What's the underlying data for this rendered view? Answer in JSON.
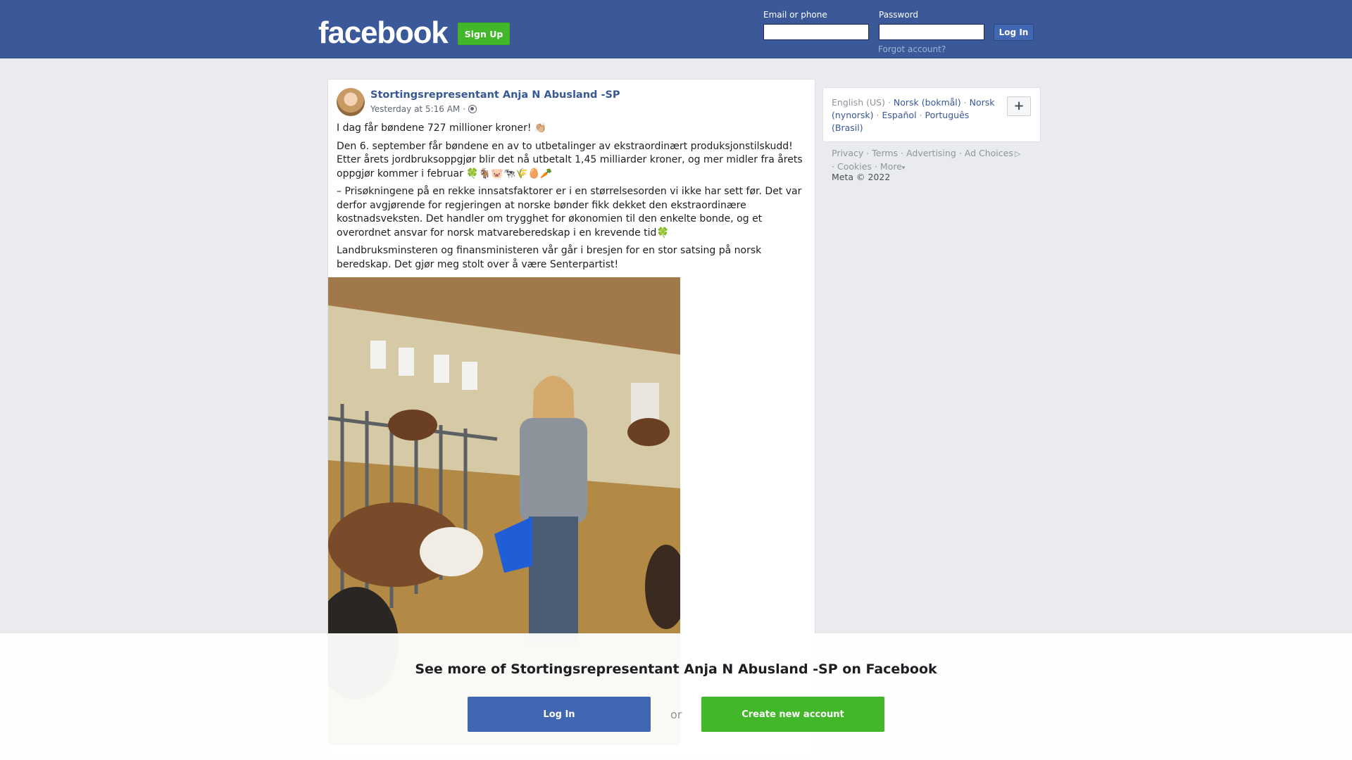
{
  "header": {
    "logo": "facebook",
    "signup_label": "Sign Up",
    "email_label": "Email or phone",
    "password_label": "Password",
    "login_label": "Log In",
    "forgot_label": "Forgot account?"
  },
  "post": {
    "author": "Stortingsrepresentant Anja N Abusland -SP",
    "timestamp": "Yesterday at 5:16 AM",
    "separator": "·",
    "paragraphs": [
      "I dag får bøndene 727 millioner kroner! 👏🏼",
      "Den 6. september får bøndene en av to utbetalinger av ekstraordinært produksjonstilskudd! Etter årets jordbruksoppgjør blir det nå utbetalt 1,45 milliarder kroner, og mer midler fra årets oppgjør kommer i februar 🍀🐐🐷🐄🌾🥚🥕",
      "– Prisøkningene på en rekke innsatsfaktorer er i en størrelsesorden vi ikke har sett før. Det var derfor avgjørende for regjeringen at norske bønder fikk dekket den ekstraordinære kostnadsveksten. Det handler om trygghet for økonomien til den enkelte bonde, og et overordnet ansvar for norsk matvareberedskap i en krevende tid🍀",
      "Landbruksminsteren og finansministeren vår går i bresjen for en stor satsing på norsk beredskap. Det gjør meg stolt over å være Senterpartist!"
    ]
  },
  "sidebar": {
    "languages": {
      "current": "English (US)",
      "options": [
        "Norsk (bokmål)",
        "Norsk (nynorsk)",
        "Español",
        "Português (Brasil)"
      ],
      "dot": "·"
    },
    "add_language": "+",
    "footer_links": [
      "Privacy",
      "Terms",
      "Advertising",
      "Ad Choices",
      "Cookies",
      "More"
    ],
    "more_caret": "▾",
    "copyright": "Meta © 2022"
  },
  "overlay": {
    "title": "See more of Stortingsrepresentant Anja N Abusland -SP on Facebook",
    "login_label": "Log In",
    "or_label": "or",
    "create_label": "Create new account"
  },
  "colors": {
    "brand_blue": "#3b5998",
    "button_blue": "#4267b2",
    "green": "#42b72a",
    "link": "#385898"
  },
  "icons": [
    "globe-icon",
    "ad-choices-icon",
    "plus-icon"
  ]
}
